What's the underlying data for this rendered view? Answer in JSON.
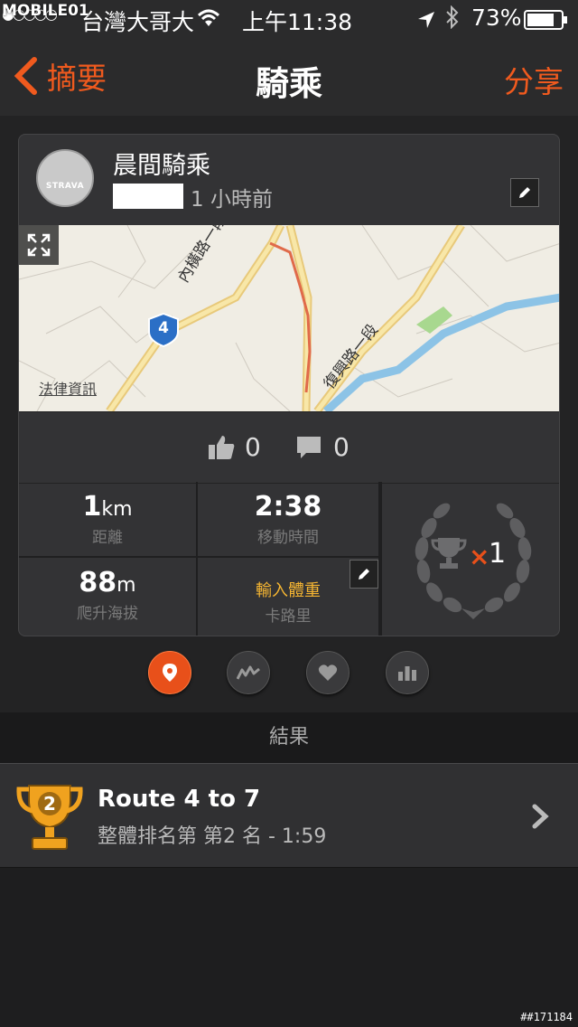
{
  "status_bar": {
    "watermark": "MOBILE01",
    "signal": "●○○○○",
    "carrier": "台灣大哥大",
    "time": "上午11:38",
    "battery": "73%",
    "wifi_icon": "wifi-icon",
    "location_icon": "location-arrow-icon",
    "bluetooth_icon": "bluetooth-icon",
    "battery_icon": "battery-icon"
  },
  "nav": {
    "back_label": "摘要",
    "title": "騎乘",
    "share_label": "分享"
  },
  "activity": {
    "title": "晨間騎乘",
    "time_ago": "1 小時前",
    "avatar_brand": "STRAVA"
  },
  "map": {
    "road_label_1": "內橫路一段",
    "road_label_2": "復興路一段",
    "route_shield": "4",
    "legal_label": "法律資訊"
  },
  "social": {
    "kudos_count": "0",
    "comments_count": "0"
  },
  "stats": {
    "distance_value": "1",
    "distance_unit": "km",
    "distance_label": "距離",
    "moving_time_value": "2:38",
    "moving_time_label": "移動時間",
    "elevation_value": "88",
    "elevation_unit": "m",
    "elevation_label": "爬升海拔",
    "weight_cta": "輸入體重",
    "calories_label": "卡路里",
    "achievements_multiplier": "×",
    "achievements_count": "1"
  },
  "tabs": [
    {
      "name": "map-tab",
      "icon": "map-pin-icon",
      "active": true
    },
    {
      "name": "elevation-tab",
      "icon": "elevation-chart-icon",
      "active": false
    },
    {
      "name": "heart-rate-tab",
      "icon": "heart-icon",
      "active": false
    },
    {
      "name": "analysis-tab",
      "icon": "bar-chart-icon",
      "active": false
    }
  ],
  "results": {
    "header": "結果",
    "items": [
      {
        "rank": "2",
        "name": "Route 4 to 7",
        "detail": "整體排名第 第2 名 - 1:59"
      }
    ]
  },
  "footer": {
    "id": "##171184"
  },
  "colors": {
    "accent": "#f05a1e",
    "gold": "#f5b532",
    "background": "#1c1c1d",
    "card": "#333335"
  }
}
